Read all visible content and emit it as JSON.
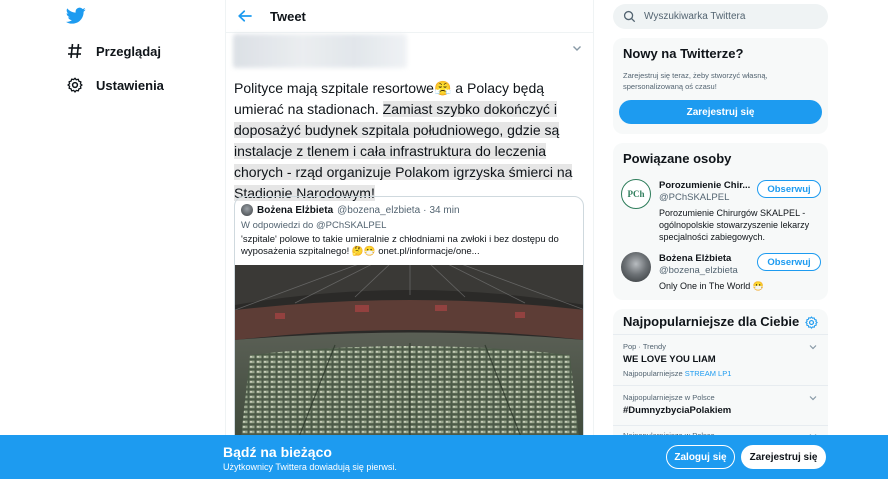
{
  "colors": {
    "accent": "#1d9bf0",
    "text": "#0f1419",
    "muted": "#536471"
  },
  "nav": {
    "logo_icon": "twitter-bird-icon",
    "items": [
      {
        "label": "Przeglądaj",
        "icon": "hashtag-icon"
      },
      {
        "label": "Ustawienia",
        "icon": "gear-icon"
      }
    ]
  },
  "header": {
    "title": "Tweet"
  },
  "tweet": {
    "text_plain": "Polityce mają szpitale resortowe",
    "text_emoji": "😤",
    "text_after_emoji": " a Polacy będą umierać na stadionach. ",
    "text_highlighted": "Zamiast szybko dokończyć i doposażyć budynek szpitala południowego, gdzie są instalacje z tlenem i cała infrastruktura do leczenia chorych - rząd organizuje Polakom igrzyska śmierci na Stadionie Narodowym!"
  },
  "quote": {
    "name": "Bożena Elżbieta",
    "handle": "@bozena_elzbieta",
    "sep": "·",
    "time": "34 min",
    "reply_to": "W odpowiedzi do @PChSKALPEL",
    "text": "'szpitale' polowe to takie umieralnie z chłodniami na zwłoki i bez dostępu do wyposażenia szpitalnego! 🤔😷 onet.pl/informacje/one..."
  },
  "search": {
    "placeholder": "Wyszukiwarka Twittera"
  },
  "new_to_twitter": {
    "title": "Nowy na Twitterze?",
    "desc": "Zarejestruj się teraz, żeby stworzyć własną, spersonalizowaną oś czasu!",
    "button": "Zarejestruj się"
  },
  "related": {
    "title": "Powiązane osoby",
    "people": [
      {
        "name": "Porozumienie Chir...",
        "handle": "@PChSKALPEL",
        "bio": "Porozumienie Chirurgów SKALPEL - ogólnopolskie stowarzyszenie lekarzy specjalności zabiegowych.",
        "button": "Obserwuj",
        "avatar_text": "PCh"
      },
      {
        "name": "Bożena Elżbieta",
        "handle": "@bozena_elzbieta",
        "bio": "Only One in The World 😷",
        "button": "Obserwuj"
      }
    ]
  },
  "trends": {
    "title": "Najpopularniejsze dla Ciebie",
    "items": [
      {
        "meta": "Pop · Trendy",
        "name": "WE LOVE YOU LIAM",
        "sub_prefix": "Najpopularniejsze",
        "sub_tag": "STREAM LP1"
      },
      {
        "meta": "Najpopularniejsze w Polsce",
        "name": "#DumnyzbyciaPolakiem",
        "sub_prefix": "",
        "sub_tag": ""
      },
      {
        "meta": "Najpopularniejsze w Polsce",
        "name": "",
        "sub_prefix": "",
        "sub_tag": ""
      }
    ]
  },
  "bottom_bar": {
    "title": "Bądź na bieżąco",
    "subtitle": "Użytkownicy Twittera dowiadują się pierwsi.",
    "login": "Zaloguj się",
    "register": "Zarejestruj się"
  }
}
